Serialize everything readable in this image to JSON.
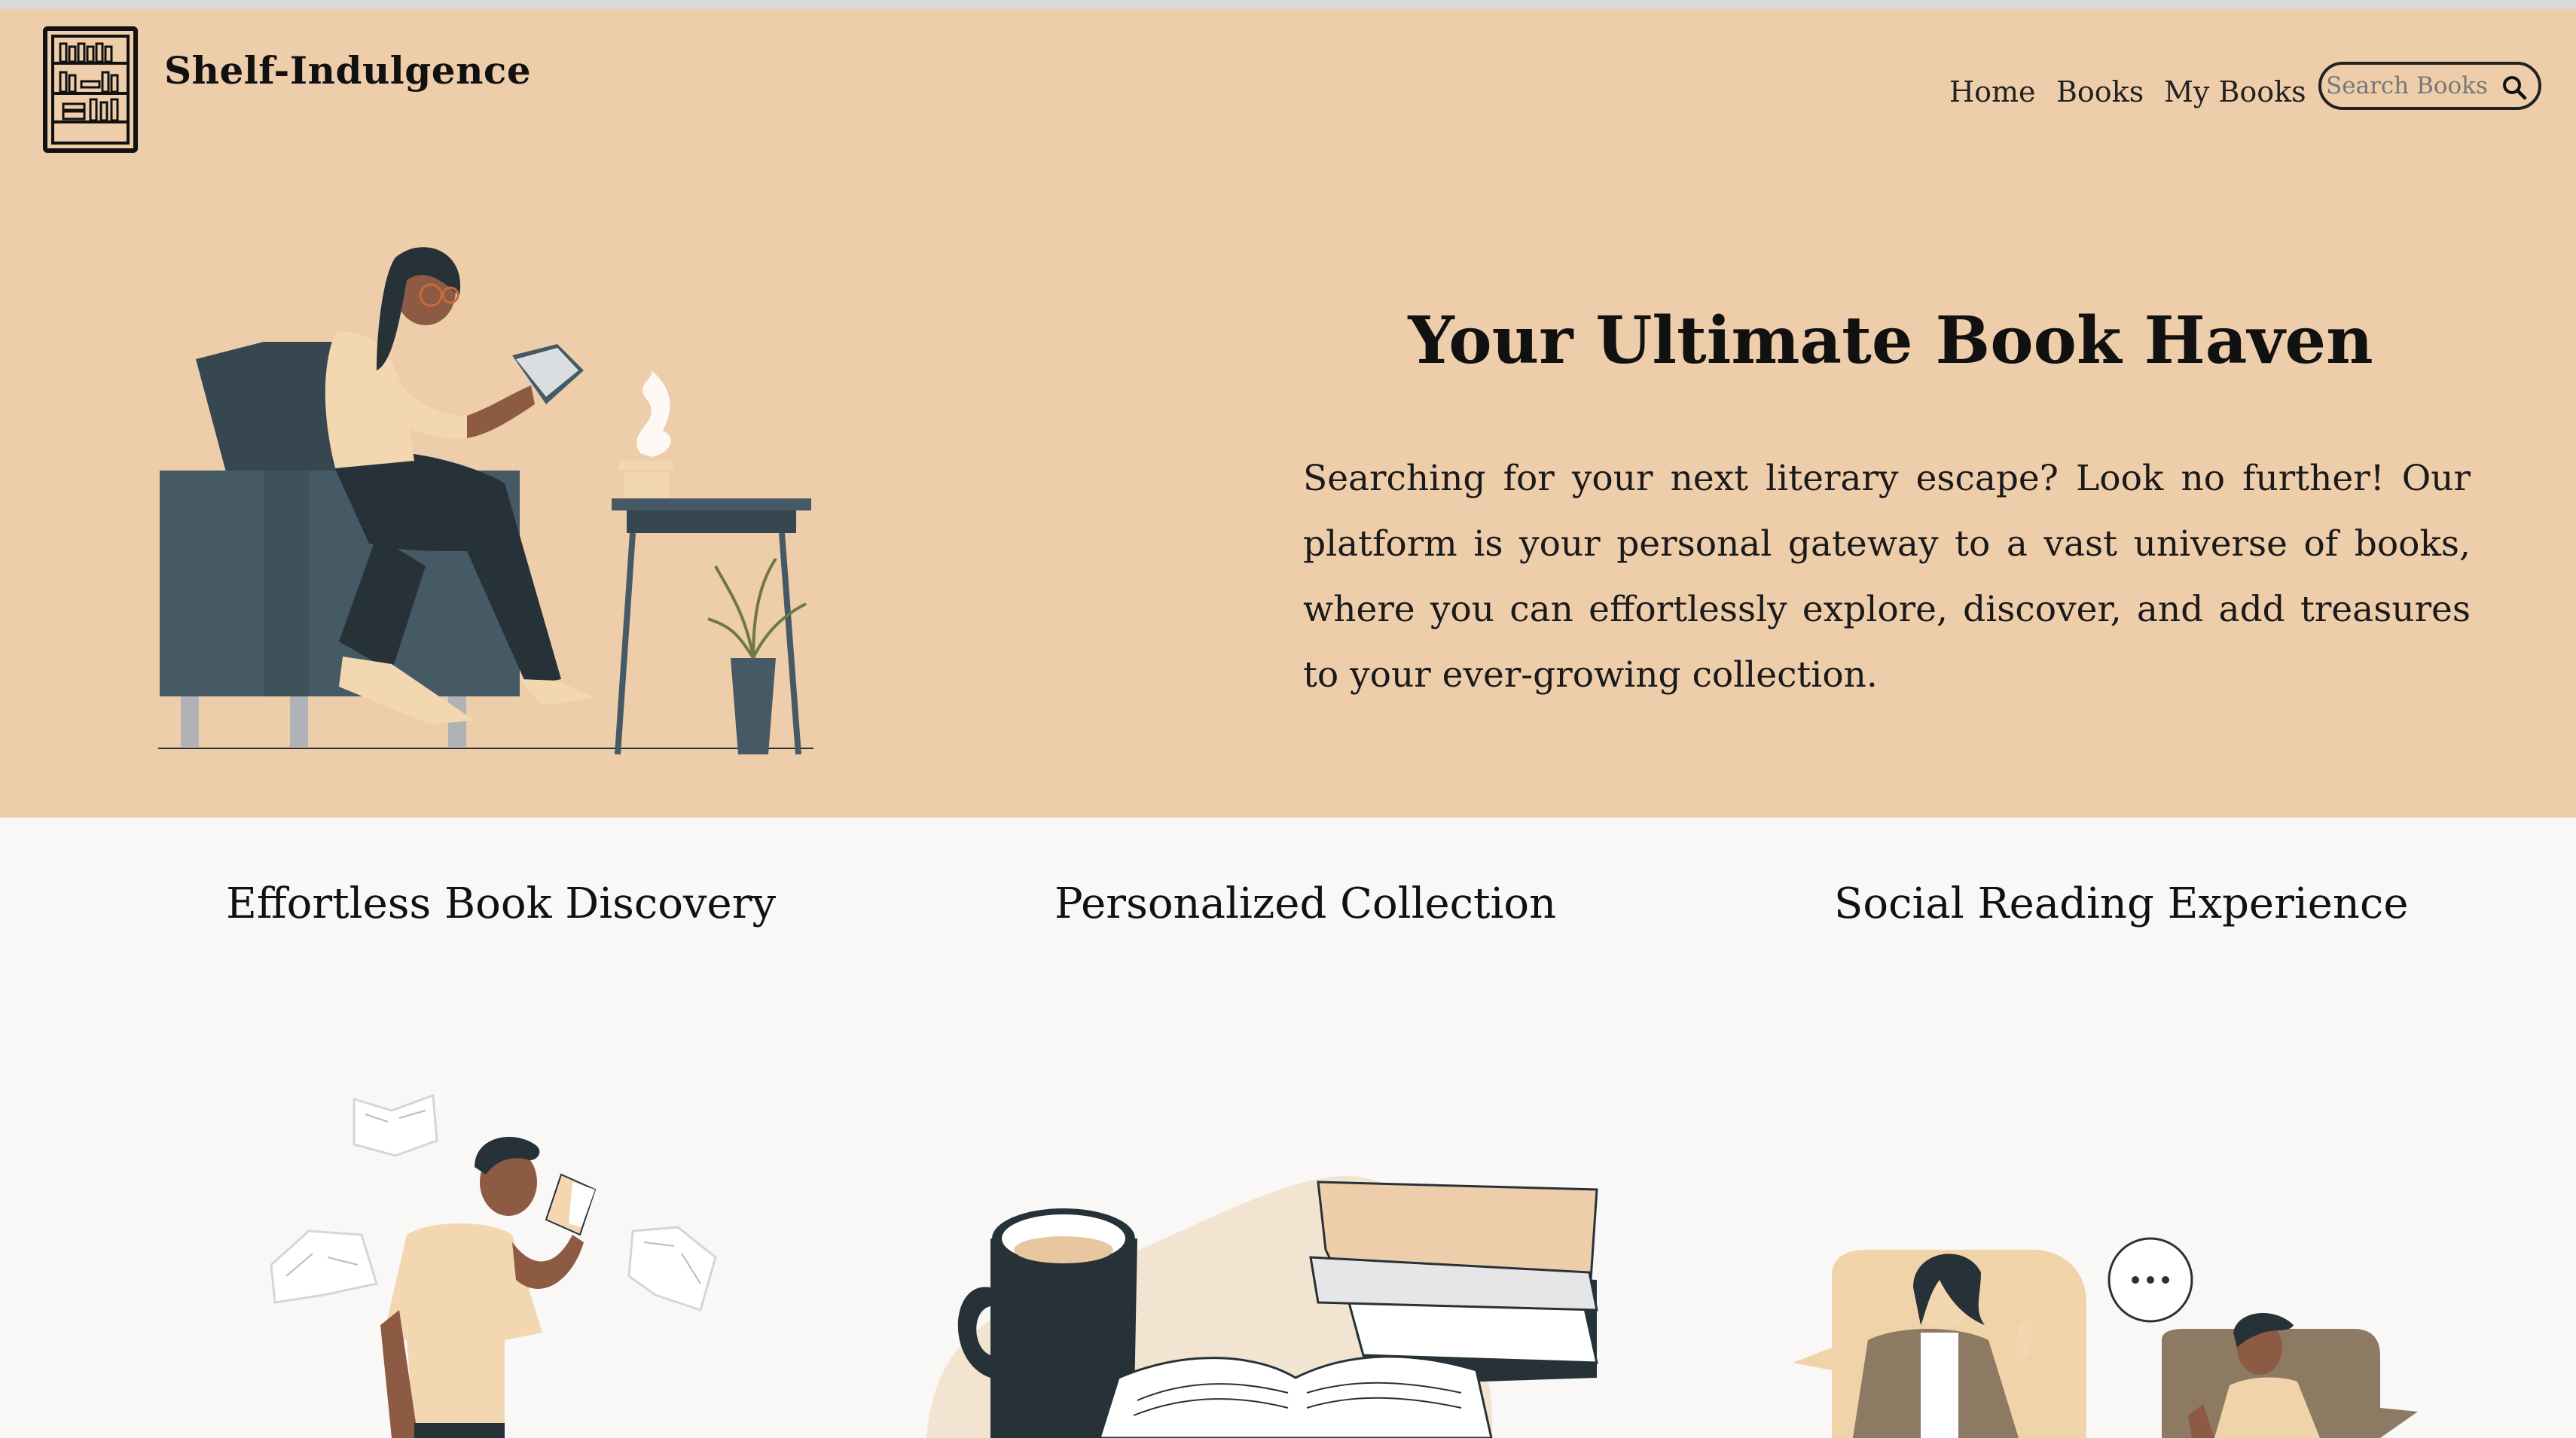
{
  "brand": {
    "name": "Shelf-Indulgence",
    "logo_icon": "bookshelf-icon"
  },
  "nav": {
    "items": [
      "Home",
      "Books",
      "My Books"
    ],
    "search_placeholder": "Search Books",
    "search_icon": "search-icon"
  },
  "hero": {
    "title": "Your Ultimate Book Haven",
    "text": "Searching for your next literary escape? Look no further! Our platform is your personal gateway to a vast universe of books, where you can effortlessly explore, discover, and add treasures to your ever-growing collection."
  },
  "features": [
    {
      "title": "Effortless Book Discovery"
    },
    {
      "title": "Personalized Collection"
    },
    {
      "title": "Social Reading Experience"
    }
  ],
  "colors": {
    "hero_bg": "#eecdab",
    "page_bg": "#faf8f6",
    "dark": "#263238",
    "chair": "#455a64",
    "accent": "#f0d3a8"
  }
}
